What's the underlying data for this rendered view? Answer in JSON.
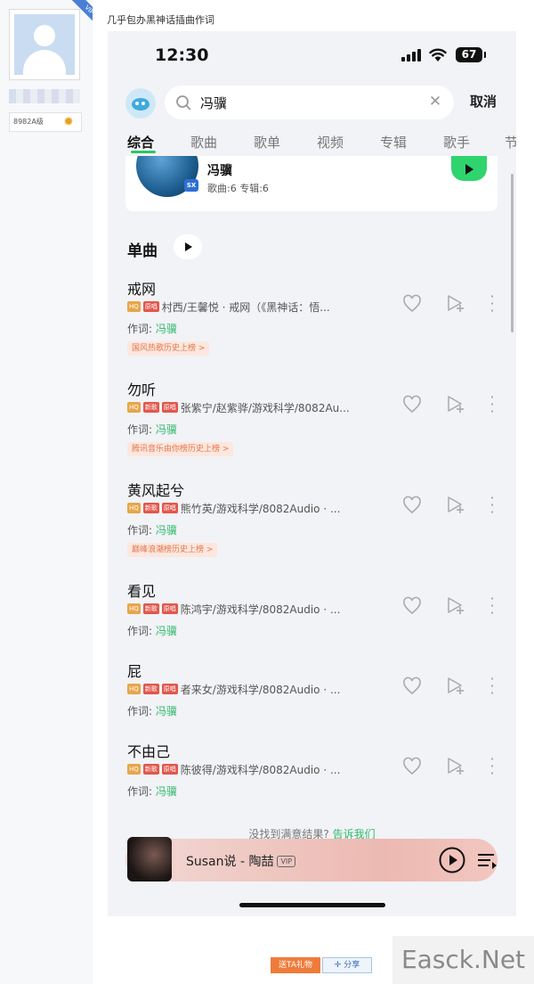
{
  "forum": {
    "vip_corner": "VIP",
    "user_tag": "8982A级",
    "post_title": "几乎包办黑神话插曲作词",
    "gift_label": "送TA礼物",
    "share_label": "分享",
    "watermark": "Easck.Net"
  },
  "status": {
    "time": "12:30",
    "battery": "67"
  },
  "search": {
    "query": "冯骥",
    "cancel_label": "取消"
  },
  "tabs": [
    "综合",
    "歌曲",
    "歌单",
    "视频",
    "专辑",
    "歌手",
    "节"
  ],
  "artist": {
    "name": "冯骥",
    "stats": "歌曲:6 专辑:6",
    "badge": "SX"
  },
  "section": {
    "title": "单曲"
  },
  "lyric_prefix": "作词:",
  "songs": [
    {
      "title": "戒网",
      "badges": [
        "HQ",
        "原唱"
      ],
      "meta": "村西/王馨悦 · 戒网（《黑神话：悟...",
      "lyricist": "冯骥",
      "chart": "国风热歌历史上榜 >"
    },
    {
      "title": "勿听",
      "badges": [
        "HQ",
        "新歌",
        "原唱"
      ],
      "meta": "张紫宁/赵紫骅/游戏科学/8082Au...",
      "lyricist": "冯骥",
      "chart": "腾讯音乐由你榜历史上榜 >"
    },
    {
      "title": "黄风起兮",
      "badges": [
        "HQ",
        "新歌",
        "原唱"
      ],
      "meta": "熊竹英/游戏科学/8082Audio · ...",
      "lyricist": "冯骥",
      "chart": "巅峰浪潮榜历史上榜 >"
    },
    {
      "title": "看见",
      "badges": [
        "HQ",
        "新歌",
        "原唱"
      ],
      "meta": "陈鸿宇/游戏科学/8082Audio · ...",
      "lyricist": "冯骥",
      "chart": ""
    },
    {
      "title": "屁",
      "badges": [
        "HQ",
        "新歌",
        "原唱"
      ],
      "meta": "者来女/游戏科学/8082Audio · ...",
      "lyricist": "冯骥",
      "chart": ""
    },
    {
      "title": "不由己",
      "badges": [
        "HQ",
        "新歌",
        "原唱"
      ],
      "meta": "陈彼得/游戏科学/8082Audio · ...",
      "lyricist": "冯骥",
      "chart": ""
    }
  ],
  "feedback": {
    "text": "没找到满意结果?",
    "link": "告诉我们"
  },
  "player": {
    "title": "Susan说 - 陶喆",
    "vip": "VIP"
  },
  "colors": {
    "accent_green": "#2fc46b",
    "badge_red": "#e2574c",
    "badge_gold": "#e6a64a"
  }
}
